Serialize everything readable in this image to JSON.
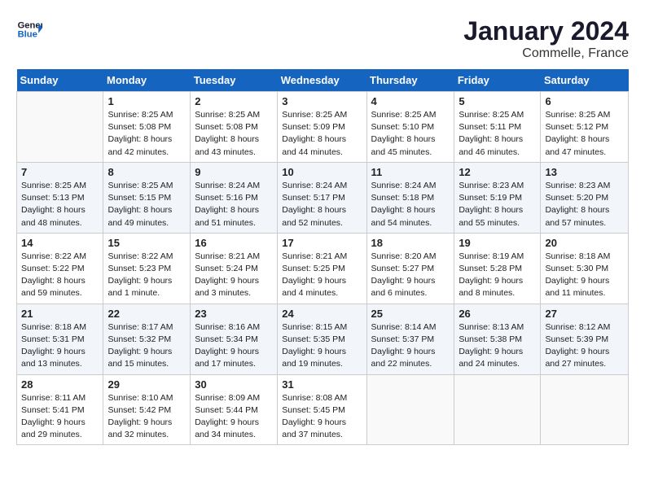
{
  "header": {
    "logo_line1": "General",
    "logo_line2": "Blue",
    "month": "January 2024",
    "location": "Commelle, France"
  },
  "weekdays": [
    "Sunday",
    "Monday",
    "Tuesday",
    "Wednesday",
    "Thursday",
    "Friday",
    "Saturday"
  ],
  "weeks": [
    [
      {
        "day": "",
        "info": ""
      },
      {
        "day": "1",
        "info": "Sunrise: 8:25 AM\nSunset: 5:08 PM\nDaylight: 8 hours\nand 42 minutes."
      },
      {
        "day": "2",
        "info": "Sunrise: 8:25 AM\nSunset: 5:08 PM\nDaylight: 8 hours\nand 43 minutes."
      },
      {
        "day": "3",
        "info": "Sunrise: 8:25 AM\nSunset: 5:09 PM\nDaylight: 8 hours\nand 44 minutes."
      },
      {
        "day": "4",
        "info": "Sunrise: 8:25 AM\nSunset: 5:10 PM\nDaylight: 8 hours\nand 45 minutes."
      },
      {
        "day": "5",
        "info": "Sunrise: 8:25 AM\nSunset: 5:11 PM\nDaylight: 8 hours\nand 46 minutes."
      },
      {
        "day": "6",
        "info": "Sunrise: 8:25 AM\nSunset: 5:12 PM\nDaylight: 8 hours\nand 47 minutes."
      }
    ],
    [
      {
        "day": "7",
        "info": "Sunrise: 8:25 AM\nSunset: 5:13 PM\nDaylight: 8 hours\nand 48 minutes."
      },
      {
        "day": "8",
        "info": "Sunrise: 8:25 AM\nSunset: 5:15 PM\nDaylight: 8 hours\nand 49 minutes."
      },
      {
        "day": "9",
        "info": "Sunrise: 8:24 AM\nSunset: 5:16 PM\nDaylight: 8 hours\nand 51 minutes."
      },
      {
        "day": "10",
        "info": "Sunrise: 8:24 AM\nSunset: 5:17 PM\nDaylight: 8 hours\nand 52 minutes."
      },
      {
        "day": "11",
        "info": "Sunrise: 8:24 AM\nSunset: 5:18 PM\nDaylight: 8 hours\nand 54 minutes."
      },
      {
        "day": "12",
        "info": "Sunrise: 8:23 AM\nSunset: 5:19 PM\nDaylight: 8 hours\nand 55 minutes."
      },
      {
        "day": "13",
        "info": "Sunrise: 8:23 AM\nSunset: 5:20 PM\nDaylight: 8 hours\nand 57 minutes."
      }
    ],
    [
      {
        "day": "14",
        "info": "Sunrise: 8:22 AM\nSunset: 5:22 PM\nDaylight: 8 hours\nand 59 minutes."
      },
      {
        "day": "15",
        "info": "Sunrise: 8:22 AM\nSunset: 5:23 PM\nDaylight: 9 hours\nand 1 minute."
      },
      {
        "day": "16",
        "info": "Sunrise: 8:21 AM\nSunset: 5:24 PM\nDaylight: 9 hours\nand 3 minutes."
      },
      {
        "day": "17",
        "info": "Sunrise: 8:21 AM\nSunset: 5:25 PM\nDaylight: 9 hours\nand 4 minutes."
      },
      {
        "day": "18",
        "info": "Sunrise: 8:20 AM\nSunset: 5:27 PM\nDaylight: 9 hours\nand 6 minutes."
      },
      {
        "day": "19",
        "info": "Sunrise: 8:19 AM\nSunset: 5:28 PM\nDaylight: 9 hours\nand 8 minutes."
      },
      {
        "day": "20",
        "info": "Sunrise: 8:18 AM\nSunset: 5:30 PM\nDaylight: 9 hours\nand 11 minutes."
      }
    ],
    [
      {
        "day": "21",
        "info": "Sunrise: 8:18 AM\nSunset: 5:31 PM\nDaylight: 9 hours\nand 13 minutes."
      },
      {
        "day": "22",
        "info": "Sunrise: 8:17 AM\nSunset: 5:32 PM\nDaylight: 9 hours\nand 15 minutes."
      },
      {
        "day": "23",
        "info": "Sunrise: 8:16 AM\nSunset: 5:34 PM\nDaylight: 9 hours\nand 17 minutes."
      },
      {
        "day": "24",
        "info": "Sunrise: 8:15 AM\nSunset: 5:35 PM\nDaylight: 9 hours\nand 19 minutes."
      },
      {
        "day": "25",
        "info": "Sunrise: 8:14 AM\nSunset: 5:37 PM\nDaylight: 9 hours\nand 22 minutes."
      },
      {
        "day": "26",
        "info": "Sunrise: 8:13 AM\nSunset: 5:38 PM\nDaylight: 9 hours\nand 24 minutes."
      },
      {
        "day": "27",
        "info": "Sunrise: 8:12 AM\nSunset: 5:39 PM\nDaylight: 9 hours\nand 27 minutes."
      }
    ],
    [
      {
        "day": "28",
        "info": "Sunrise: 8:11 AM\nSunset: 5:41 PM\nDaylight: 9 hours\nand 29 minutes."
      },
      {
        "day": "29",
        "info": "Sunrise: 8:10 AM\nSunset: 5:42 PM\nDaylight: 9 hours\nand 32 minutes."
      },
      {
        "day": "30",
        "info": "Sunrise: 8:09 AM\nSunset: 5:44 PM\nDaylight: 9 hours\nand 34 minutes."
      },
      {
        "day": "31",
        "info": "Sunrise: 8:08 AM\nSunset: 5:45 PM\nDaylight: 9 hours\nand 37 minutes."
      },
      {
        "day": "",
        "info": ""
      },
      {
        "day": "",
        "info": ""
      },
      {
        "day": "",
        "info": ""
      }
    ]
  ]
}
